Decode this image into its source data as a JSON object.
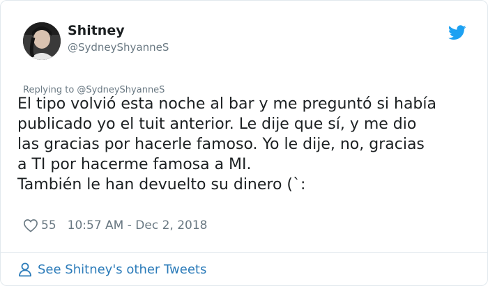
{
  "author": {
    "name": "Shitney",
    "handle": "@SydneyShyanneS"
  },
  "reply_context": "Replying to @SydneyShyanneS",
  "tweet_text": "El tipo volvió esta noche al bar y me preguntó si había\npublicado yo el tuit anterior. Le dije que sí, y me dio\nlas gracias por hacerle famoso. Yo le dije, no, gracias\na TI por hacerme famosa a MI.\nTambién le han devuelto su dinero (`:",
  "stats": {
    "likes": "55",
    "timestamp": "10:57 AM - Dec 2, 2018"
  },
  "footer": {
    "link_label": "See Shitney's other Tweets"
  },
  "icons": {
    "logo": "twitter-bird-icon",
    "like": "heart-icon",
    "profile": "person-icon"
  },
  "colors": {
    "brand_blue": "#1da1f2",
    "link_blue": "#2b7bb9",
    "muted_text": "#697882",
    "border": "#e1e8ed"
  }
}
